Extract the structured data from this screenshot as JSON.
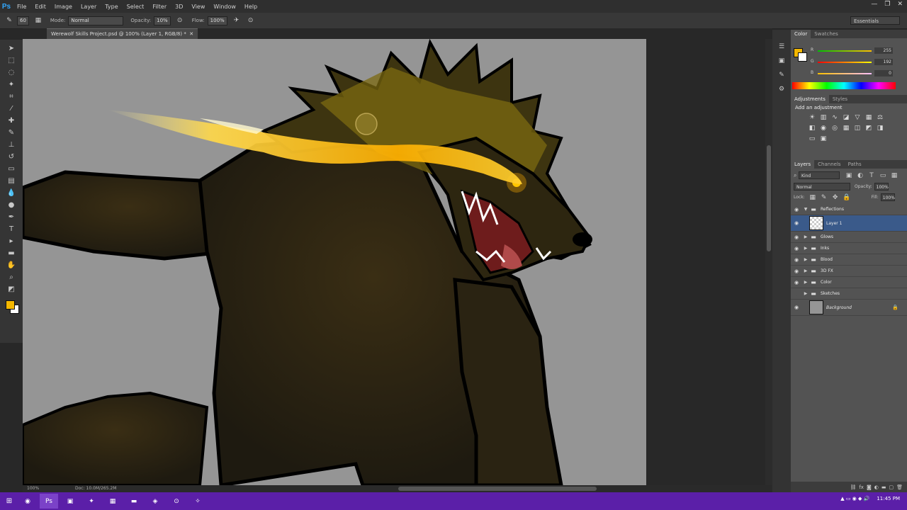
{
  "app": {
    "logo": "Ps"
  },
  "menu": [
    "File",
    "Edit",
    "Image",
    "Layer",
    "Type",
    "Select",
    "Filter",
    "3D",
    "View",
    "Window",
    "Help"
  ],
  "window_controls": [
    "—",
    "❐",
    "✕"
  ],
  "options_bar": {
    "brush_size": "60",
    "mode_label": "Mode:",
    "mode_value": "Normal",
    "opacity_label": "Opacity:",
    "opacity_value": "10%",
    "flow_label": "Flow:",
    "flow_value": "100%",
    "workspace": "Essentials"
  },
  "document": {
    "tab_title": "Werewolf Skills Project.psd @ 100% (Layer 1, RGB/8) *"
  },
  "status": {
    "zoom": "100%",
    "doc_size": "Doc: 10.0M/265.2M"
  },
  "colors": {
    "foreground": "#f5b800",
    "background": "#ffffff"
  },
  "color_panel": {
    "tabs": [
      "Color",
      "Swatches"
    ],
    "r_label": "R",
    "g_label": "G",
    "b_label": "B",
    "r_value": "255",
    "g_value": "192",
    "b_value": "0"
  },
  "adjustments_panel": {
    "tabs": [
      "Adjustments",
      "Styles"
    ],
    "title": "Add an adjustment"
  },
  "layers_panel": {
    "tabs": [
      "Layers",
      "Channels",
      "Paths"
    ],
    "kind": "Kind",
    "blend_mode": "Normal",
    "opacity_label": "Opacity:",
    "opacity_value": "100%",
    "lock_label": "Lock:",
    "fill_label": "Fill:",
    "fill_value": "100%",
    "layers": [
      {
        "name": "Reflections"
      },
      {
        "name": "Layer 1"
      },
      {
        "name": "Glows"
      },
      {
        "name": "Inks"
      },
      {
        "name": "Blood"
      },
      {
        "name": "3D FX"
      },
      {
        "name": "Color"
      },
      {
        "name": "Sketches"
      },
      {
        "name": "Background"
      }
    ]
  },
  "taskbar": {
    "time": "11:45 PM"
  }
}
